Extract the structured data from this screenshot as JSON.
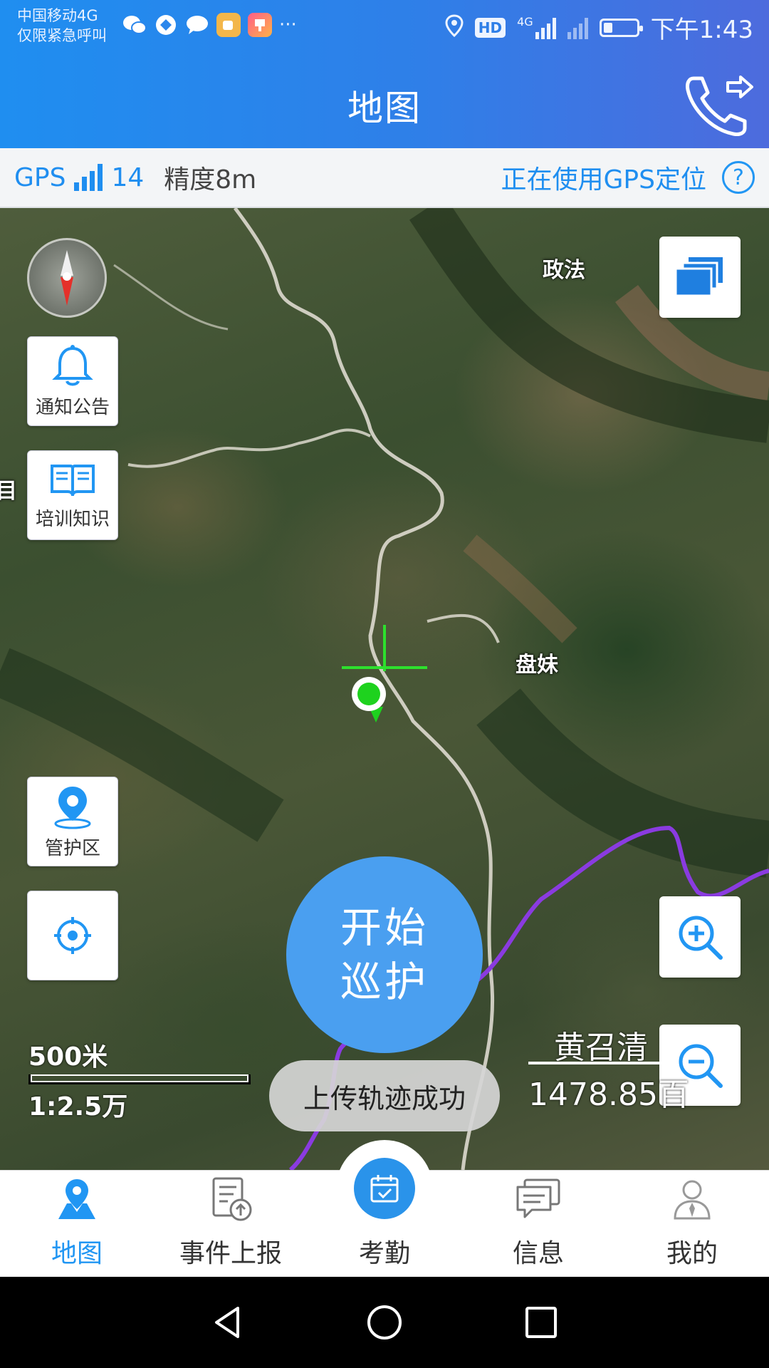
{
  "status_bar": {
    "carrier_line1": "中国移动4G",
    "carrier_line2": "仅限紧急呼叫",
    "more": "···",
    "hd": "HD",
    "network": "4G",
    "time": "下午1:43"
  },
  "header": {
    "title": "地图",
    "call_icon": "phone-forward-icon"
  },
  "gps_bar": {
    "gps_label": "GPS",
    "satellites": "14",
    "accuracy": "精度8m",
    "status": "正在使用GPS定位",
    "help_symbol": "?"
  },
  "map": {
    "places": [
      {
        "name": "政法"
      },
      {
        "name": "盘妹"
      }
    ],
    "edge_glyph": "目",
    "scale_distance": "500米",
    "scale_ratio": "1:2.5万",
    "overlay_name": "黄召清",
    "overlay_value": "1478.85",
    "overlay_value_tail": "百",
    "route_color": "#8a3be0"
  },
  "side_buttons": {
    "notice_label": "通知公告",
    "training_label": "培训知识",
    "zone_label": "管护区"
  },
  "start_patrol": {
    "line1": "开始",
    "line2": "巡护"
  },
  "toast": "上传轨迹成功",
  "tabs": [
    {
      "label": "地图",
      "icon": "map-pin-icon"
    },
    {
      "label": "事件上报",
      "icon": "report-upload-icon"
    },
    {
      "label": "考勤",
      "icon": "calendar-check-icon"
    },
    {
      "label": "信息",
      "icon": "message-icon"
    },
    {
      "label": "我的",
      "icon": "user-icon"
    }
  ],
  "colors": {
    "accent": "#2196f3",
    "header_start": "#1f8ef0",
    "header_end": "#4d6bdd",
    "start_button": "#4a9ff0"
  }
}
